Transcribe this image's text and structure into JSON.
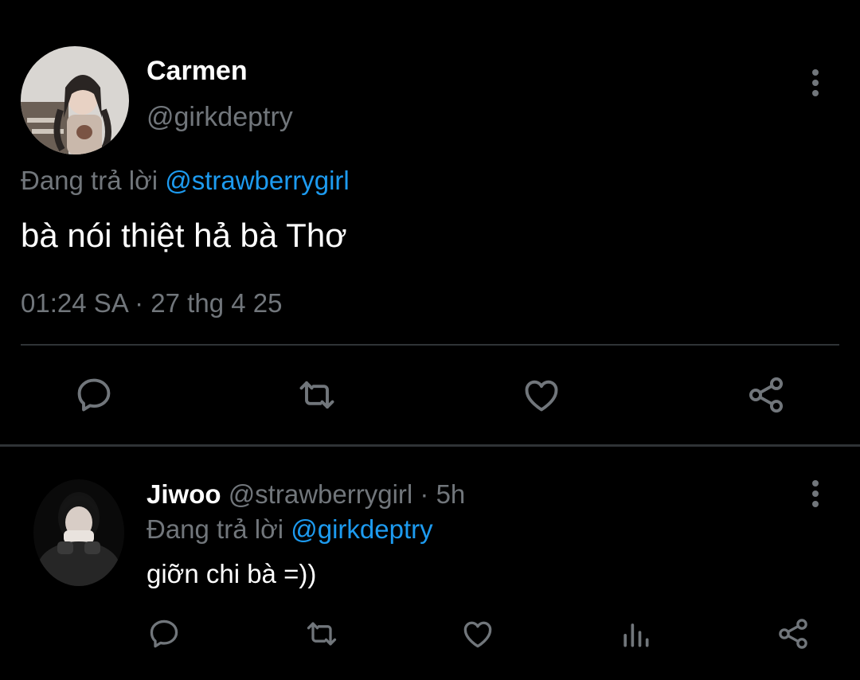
{
  "main_tweet": {
    "author_name": "Carmen",
    "author_handle": "@girkdeptry",
    "replying_prefix": "Đang trả lời",
    "replying_to": "@strawberrygirl",
    "text": "bà nói thiệt hả bà Thơ",
    "time": "01:24 SA",
    "separator": "·",
    "date": "27 thg 4 25",
    "actions": [
      "reply-icon",
      "retweet-icon",
      "like-icon",
      "share-icon"
    ]
  },
  "reply_tweet": {
    "author_name": "Jiwoo",
    "author_handle": "@strawberrygirl",
    "separator": "·",
    "age": "5h",
    "replying_prefix": "Đang trả lời",
    "replying_to": "@girkdeptry",
    "text": "giỡn chi bà =))",
    "actions": [
      "reply-icon",
      "retweet-icon",
      "like-icon",
      "analytics-icon",
      "share-icon"
    ]
  },
  "colors": {
    "background": "#000000",
    "text": "#ffffff",
    "secondary": "#71767b",
    "link": "#1d9bf0",
    "divider": "#2f3336"
  }
}
